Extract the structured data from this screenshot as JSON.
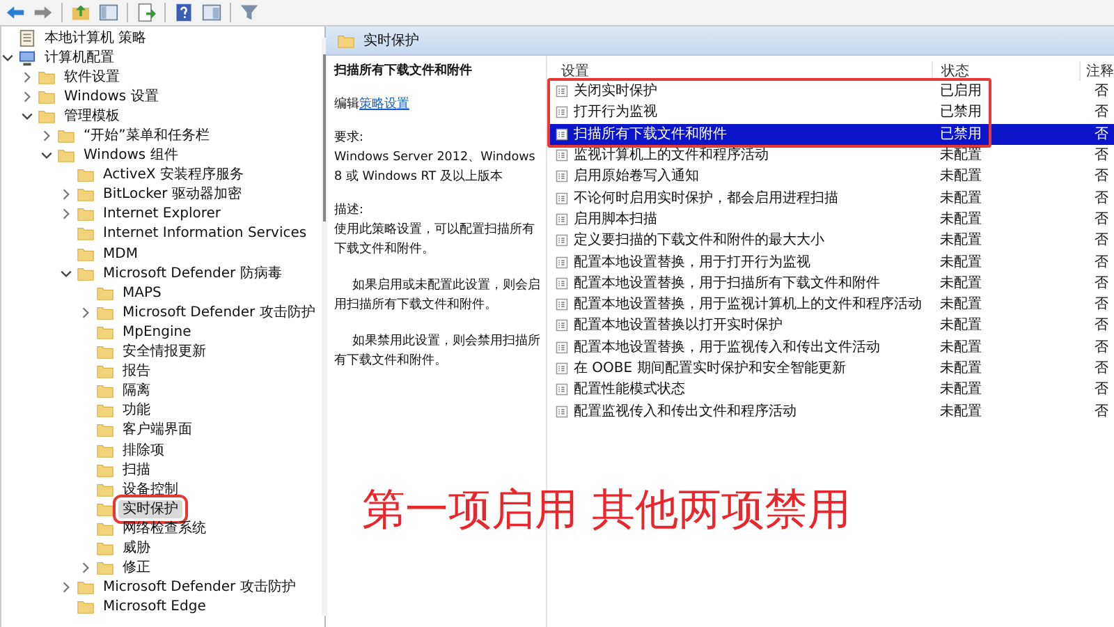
{
  "tree": [
    {
      "label": "本地计算机 策略",
      "kind": "policy",
      "selected": false,
      "marked": false,
      "children": [
        {
          "label": "计算机配置",
          "kind": "computer",
          "expanded": true,
          "selected": false,
          "marked": false,
          "children": [
            {
              "label": "软件设置",
              "kind": "folder",
              "expanded": false,
              "selected": false,
              "marked": false
            },
            {
              "label": "Windows 设置",
              "kind": "folder",
              "expanded": false,
              "selected": false,
              "marked": false
            },
            {
              "label": "管理模板",
              "kind": "folder",
              "expanded": true,
              "selected": false,
              "marked": false,
              "children": [
                {
                  "label": "“开始”菜单和任务栏",
                  "kind": "folder",
                  "expanded": false,
                  "selected": false,
                  "marked": false
                },
                {
                  "label": "Windows 组件",
                  "kind": "folder",
                  "expanded": true,
                  "selected": false,
                  "marked": false,
                  "children": [
                    {
                      "label": "ActiveX 安装程序服务",
                      "kind": "folder",
                      "selected": false,
                      "marked": false
                    },
                    {
                      "label": "BitLocker 驱动器加密",
                      "kind": "folder",
                      "expanded": false,
                      "selected": false,
                      "marked": false
                    },
                    {
                      "label": "Internet Explorer",
                      "kind": "folder",
                      "expanded": false,
                      "selected": false,
                      "marked": false
                    },
                    {
                      "label": "Internet Information Services",
                      "kind": "folder",
                      "selected": false,
                      "marked": false
                    },
                    {
                      "label": "MDM",
                      "kind": "folder",
                      "selected": false,
                      "marked": false
                    },
                    {
                      "label": "Microsoft Defender 防病毒",
                      "kind": "folder",
                      "expanded": true,
                      "selected": false,
                      "marked": false,
                      "children": [
                        {
                          "label": "MAPS",
                          "kind": "folder",
                          "selected": false,
                          "marked": false
                        },
                        {
                          "label": "Microsoft Defender 攻击防护",
                          "kind": "folder",
                          "expanded": false,
                          "selected": false,
                          "marked": false
                        },
                        {
                          "label": "MpEngine",
                          "kind": "folder",
                          "selected": false,
                          "marked": false
                        },
                        {
                          "label": "安全情报更新",
                          "kind": "folder",
                          "selected": false,
                          "marked": false
                        },
                        {
                          "label": "报告",
                          "kind": "folder",
                          "selected": false,
                          "marked": false
                        },
                        {
                          "label": "隔离",
                          "kind": "folder",
                          "selected": false,
                          "marked": false
                        },
                        {
                          "label": "功能",
                          "kind": "folder",
                          "selected": false,
                          "marked": false
                        },
                        {
                          "label": "客户端界面",
                          "kind": "folder",
                          "selected": false,
                          "marked": false
                        },
                        {
                          "label": "排除项",
                          "kind": "folder",
                          "selected": false,
                          "marked": false
                        },
                        {
                          "label": "扫描",
                          "kind": "folder",
                          "selected": false,
                          "marked": false
                        },
                        {
                          "label": "设备控制",
                          "kind": "folder",
                          "selected": false,
                          "marked": false
                        },
                        {
                          "label": "实时保护",
                          "kind": "folder",
                          "selected": true,
                          "marked": true
                        },
                        {
                          "label": "网络检查系统",
                          "kind": "folder",
                          "selected": false,
                          "marked": false
                        },
                        {
                          "label": "威胁",
                          "kind": "folder",
                          "selected": false,
                          "marked": false
                        },
                        {
                          "label": "修正",
                          "kind": "folder",
                          "expanded": false,
                          "selected": false,
                          "marked": false
                        }
                      ]
                    },
                    {
                      "label": "Microsoft Defender 攻击防护",
                      "kind": "folder",
                      "expanded": false,
                      "selected": false,
                      "marked": false
                    },
                    {
                      "label": "Microsoft Edge",
                      "kind": "folder",
                      "selected": false,
                      "marked": false
                    }
                  ]
                }
              ]
            }
          ]
        }
      ]
    }
  ],
  "details": {
    "header": "实时保护",
    "title": "扫描所有下载文件和附件",
    "edit_prefix": "编辑",
    "edit_link": "策略设置",
    "requirements_label": "要求:",
    "requirements": "Windows Server 2012、Windows 8 或 Windows RT 及以上版本",
    "description_label": "描述:",
    "paragraphs": [
      "使用此策略设置，可以配置扫描所有下载文件和附件。",
      "如果启用或未配置此设置，则会启用扫描所有下载文件和附件。",
      "如果禁用此设置，则会禁用扫描所有下载文件和附件。"
    ]
  },
  "table": {
    "columns": [
      "设置",
      "状态",
      "注释"
    ],
    "rows": [
      {
        "setting": "关闭实时保护",
        "state": "已启用",
        "comment": "否",
        "selected": false,
        "marked": true
      },
      {
        "setting": "打开行为监视",
        "state": "已禁用",
        "comment": "否",
        "selected": false,
        "marked": true
      },
      {
        "setting": "扫描所有下载文件和附件",
        "state": "已禁用",
        "comment": "否",
        "selected": true,
        "marked": true
      },
      {
        "setting": "监视计算机上的文件和程序活动",
        "state": "未配置",
        "comment": "否",
        "selected": false,
        "marked": false
      },
      {
        "setting": "启用原始卷写入通知",
        "state": "未配置",
        "comment": "否",
        "selected": false,
        "marked": false
      },
      {
        "setting": "不论何时启用实时保护，都会启用进程扫描",
        "state": "未配置",
        "comment": "否",
        "selected": false,
        "marked": false
      },
      {
        "setting": "启用脚本扫描",
        "state": "未配置",
        "comment": "否",
        "selected": false,
        "marked": false
      },
      {
        "setting": "定义要扫描的下载文件和附件的最大大小",
        "state": "未配置",
        "comment": "否",
        "selected": false,
        "marked": false
      },
      {
        "setting": "配置本地设置替换，用于打开行为监视",
        "state": "未配置",
        "comment": "否",
        "selected": false,
        "marked": false
      },
      {
        "setting": "配置本地设置替换，用于扫描所有下载文件和附件",
        "state": "未配置",
        "comment": "否",
        "selected": false,
        "marked": false
      },
      {
        "setting": "配置本地设置替换，用于监视计算机上的文件和程序活动",
        "state": "未配置",
        "comment": "否",
        "selected": false,
        "marked": false
      },
      {
        "setting": "配置本地设置替换以打开实时保护",
        "state": "未配置",
        "comment": "否",
        "selected": false,
        "marked": false
      },
      {
        "setting": "配置本地设置替换，用于监视传入和传出文件活动",
        "state": "未配置",
        "comment": "否",
        "selected": false,
        "marked": false
      },
      {
        "setting": "在 OOBE 期间配置实时保护和安全智能更新",
        "state": "未配置",
        "comment": "否",
        "selected": false,
        "marked": false
      },
      {
        "setting": "配置性能模式状态",
        "state": "未配置",
        "comment": "否",
        "selected": false,
        "marked": false
      },
      {
        "setting": "配置监视传入和传出文件和程序活动",
        "state": "未配置",
        "comment": "否",
        "selected": false,
        "marked": false
      }
    ]
  },
  "caption": "第一项启用 其他两项禁用"
}
